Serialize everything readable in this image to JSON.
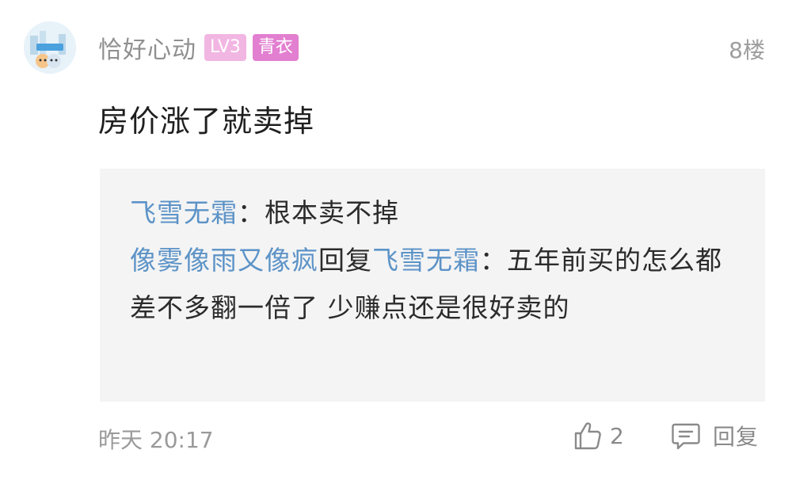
{
  "comment": {
    "username": "恰好心动",
    "level_badge": "LV3",
    "title_badge": "青衣",
    "floor": "8楼",
    "content": "房价涨了就卖掉",
    "time": "昨天 20:17",
    "like_count": "2",
    "reply_label": "回复"
  },
  "replies": [
    {
      "author": "飞雪无霜",
      "separator": "：",
      "text": "根本卖不掉"
    },
    {
      "author": "像雾像雨又像疯",
      "reply_word": "回复",
      "target": "飞雪无霜",
      "separator": "：",
      "text": "五年前买的怎么都差不多翻一倍了 少赚点还是很好卖的"
    }
  ],
  "colors": {
    "username_link": "#5c93c7",
    "level_badge_bg": "#f2b6e3",
    "title_badge_bg": "#e27fd0",
    "quote_bg": "#f4f4f4"
  },
  "icons": {
    "like": "thumbs-up-icon",
    "reply": "comment-bubble-icon"
  }
}
